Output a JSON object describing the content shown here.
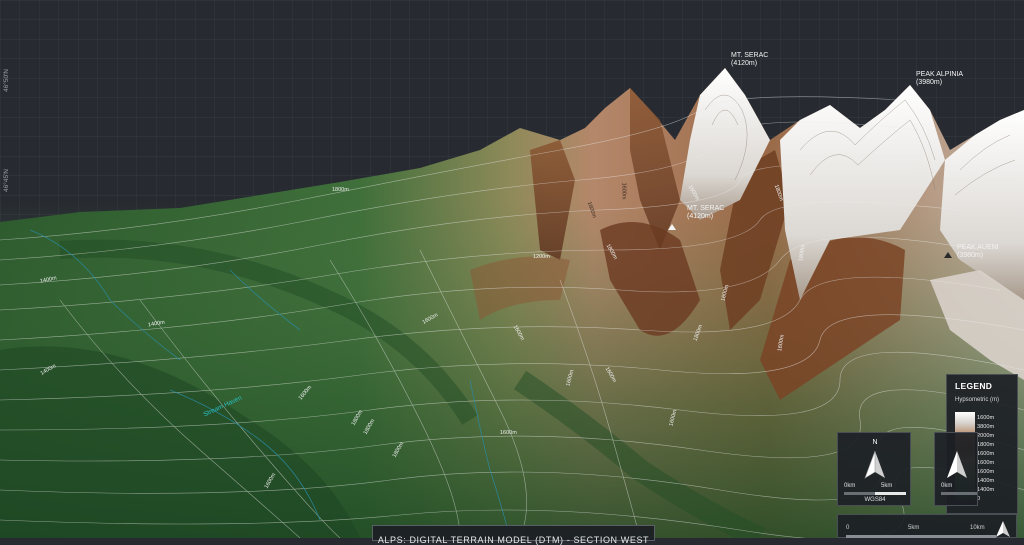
{
  "map": {
    "latitude_labels": [
      "46°50'N",
      "46°45'N"
    ],
    "peaks": [
      {
        "name": "MT. SERAC",
        "elev": "(4120m)"
      },
      {
        "name": "PEAK ALPINIA",
        "elev": "(3980m)"
      },
      {
        "name": "MT. SERAC",
        "elev": "(4120m)"
      },
      {
        "name": "PEAK AUENI",
        "elev": "(3980m)"
      }
    ],
    "contour_labels": [
      "1800m",
      "1400m",
      "1400m",
      "1400m",
      "1600m",
      "1800m",
      "1800m",
      "1800m",
      "1600m",
      "1600m",
      "1600m",
      "1600m",
      "1600m",
      "1800m",
      "1600m",
      "1600m",
      "1600m",
      "1600m",
      "1800m",
      "1800m",
      "1600m",
      "1600m",
      "1200m",
      "1600m",
      "1800m"
    ],
    "stream_label": "Stream Haven",
    "title": "ALPS: DIGITAL TERRAIN MODEL (DTM) - SECTION WEST"
  },
  "legend": {
    "title": "LEGEND",
    "subtitle": "Hypsometric (m)",
    "entries": [
      "1600m",
      "3800m",
      "2000m",
      "1800m",
      "1600m",
      "1600m",
      "1600m",
      "1400m",
      "1400m",
      "0"
    ]
  },
  "north_box": {
    "north": "N",
    "scale_start": "0km",
    "scale_end": "5km",
    "crs": "WGS84"
  },
  "north_box_2": {
    "scale_start": "0km"
  },
  "scale_bar": {
    "labels": [
      "0",
      "5km",
      "10km"
    ]
  },
  "colors": {
    "background": "#272b31",
    "grid": "#3a3f46",
    "lowland": "#2f5a2e",
    "midland": "#a27752",
    "rock": "#6e3e22",
    "snow": "#f3f1ee",
    "stream": "#2bbfc4"
  }
}
